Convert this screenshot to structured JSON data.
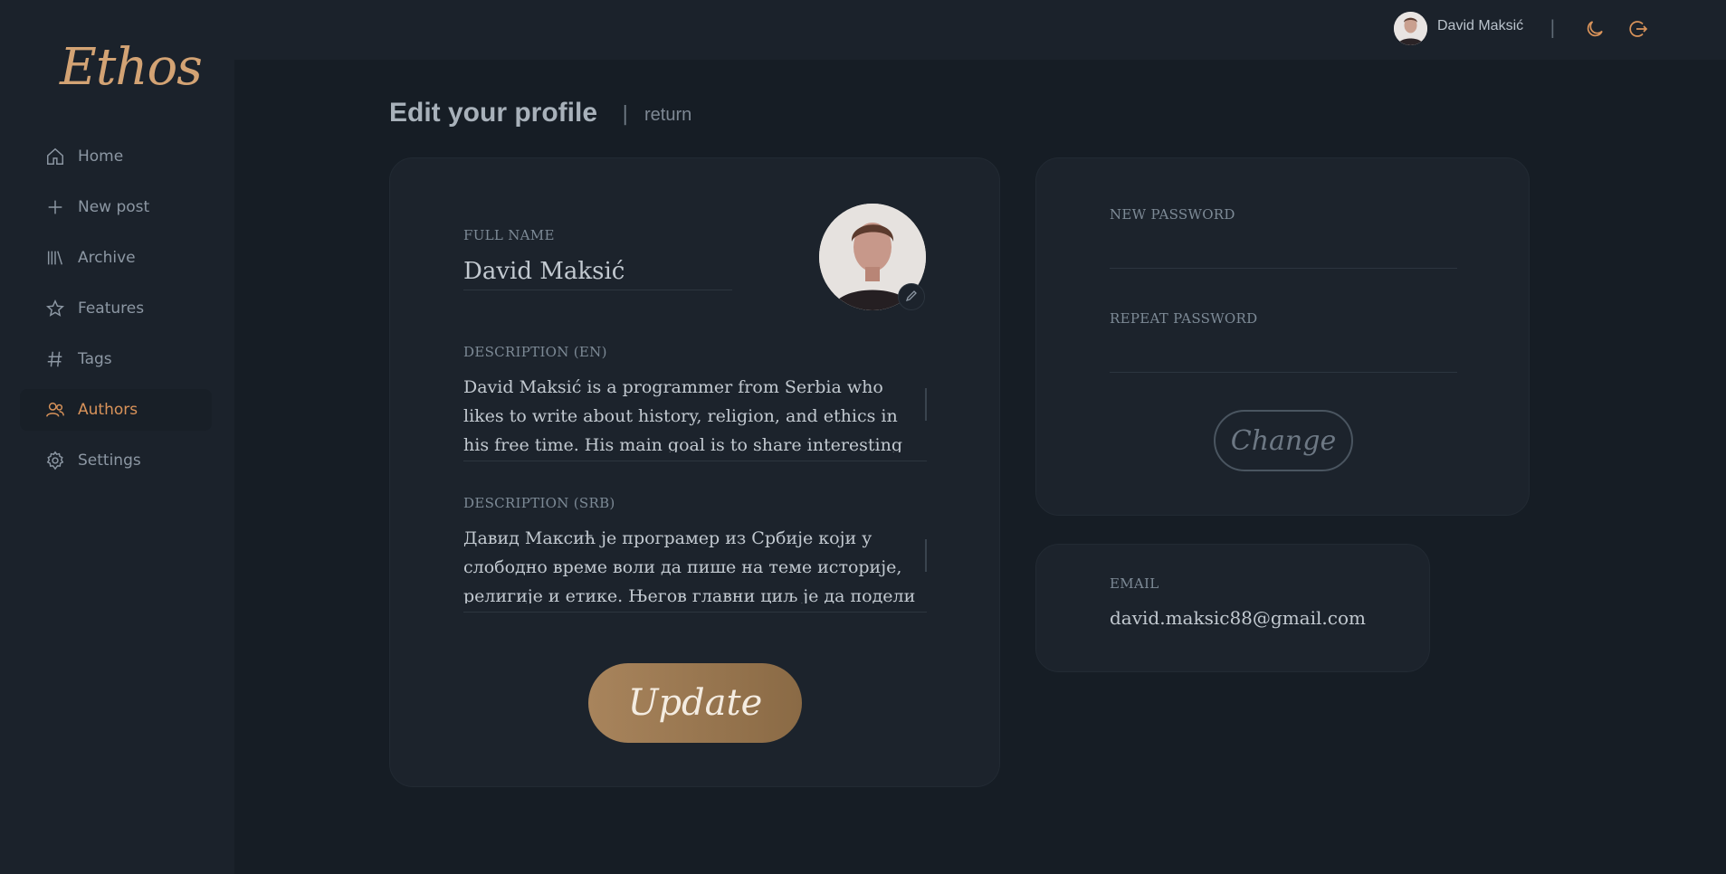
{
  "app": {
    "logo": "Ethos"
  },
  "sidebar": {
    "items": [
      {
        "label": "Home",
        "icon": "home-icon",
        "active": false
      },
      {
        "label": "New post",
        "icon": "plus-icon",
        "active": false
      },
      {
        "label": "Archive",
        "icon": "archive-icon",
        "active": false
      },
      {
        "label": "Features",
        "icon": "star-icon",
        "active": false
      },
      {
        "label": "Tags",
        "icon": "hash-icon",
        "active": false
      },
      {
        "label": "Authors",
        "icon": "users-icon",
        "active": true
      },
      {
        "label": "Settings",
        "icon": "gear-icon",
        "active": false
      }
    ]
  },
  "topbar": {
    "user_name": "David Maksić",
    "separator": "|",
    "theme_icon": "moon-icon",
    "logout_icon": "logout-icon"
  },
  "page": {
    "title": "Edit your profile",
    "separator": "|",
    "return_label": "return"
  },
  "profile": {
    "full_name_label": "FULL NAME",
    "full_name": "David Maksić",
    "desc_en_label": "DESCRIPTION (EN)",
    "desc_en": "David Maksić is a programmer from Serbia who likes to write about history, religion, and ethics in his free time. His main goal is to share interesting and",
    "desc_srb_label": "DESCRIPTION (SRB)",
    "desc_srb": "Давид Максић је програмер из Србије који у слободно време воли да пише на теме историје, религије и етике. Његов главни циљ је да подели",
    "update_label": "Update"
  },
  "password": {
    "new_label": "NEW PASSWORD",
    "new_value": "",
    "repeat_label": "REPEAT PASSWORD",
    "repeat_value": "",
    "change_label": "Change"
  },
  "email": {
    "label": "EMAIL",
    "value": "david.maksic88@gmail.com"
  },
  "colors": {
    "accent": "#d9935a",
    "logo": "#d3a374",
    "background": "#161d25",
    "panel": "#1c232c"
  }
}
